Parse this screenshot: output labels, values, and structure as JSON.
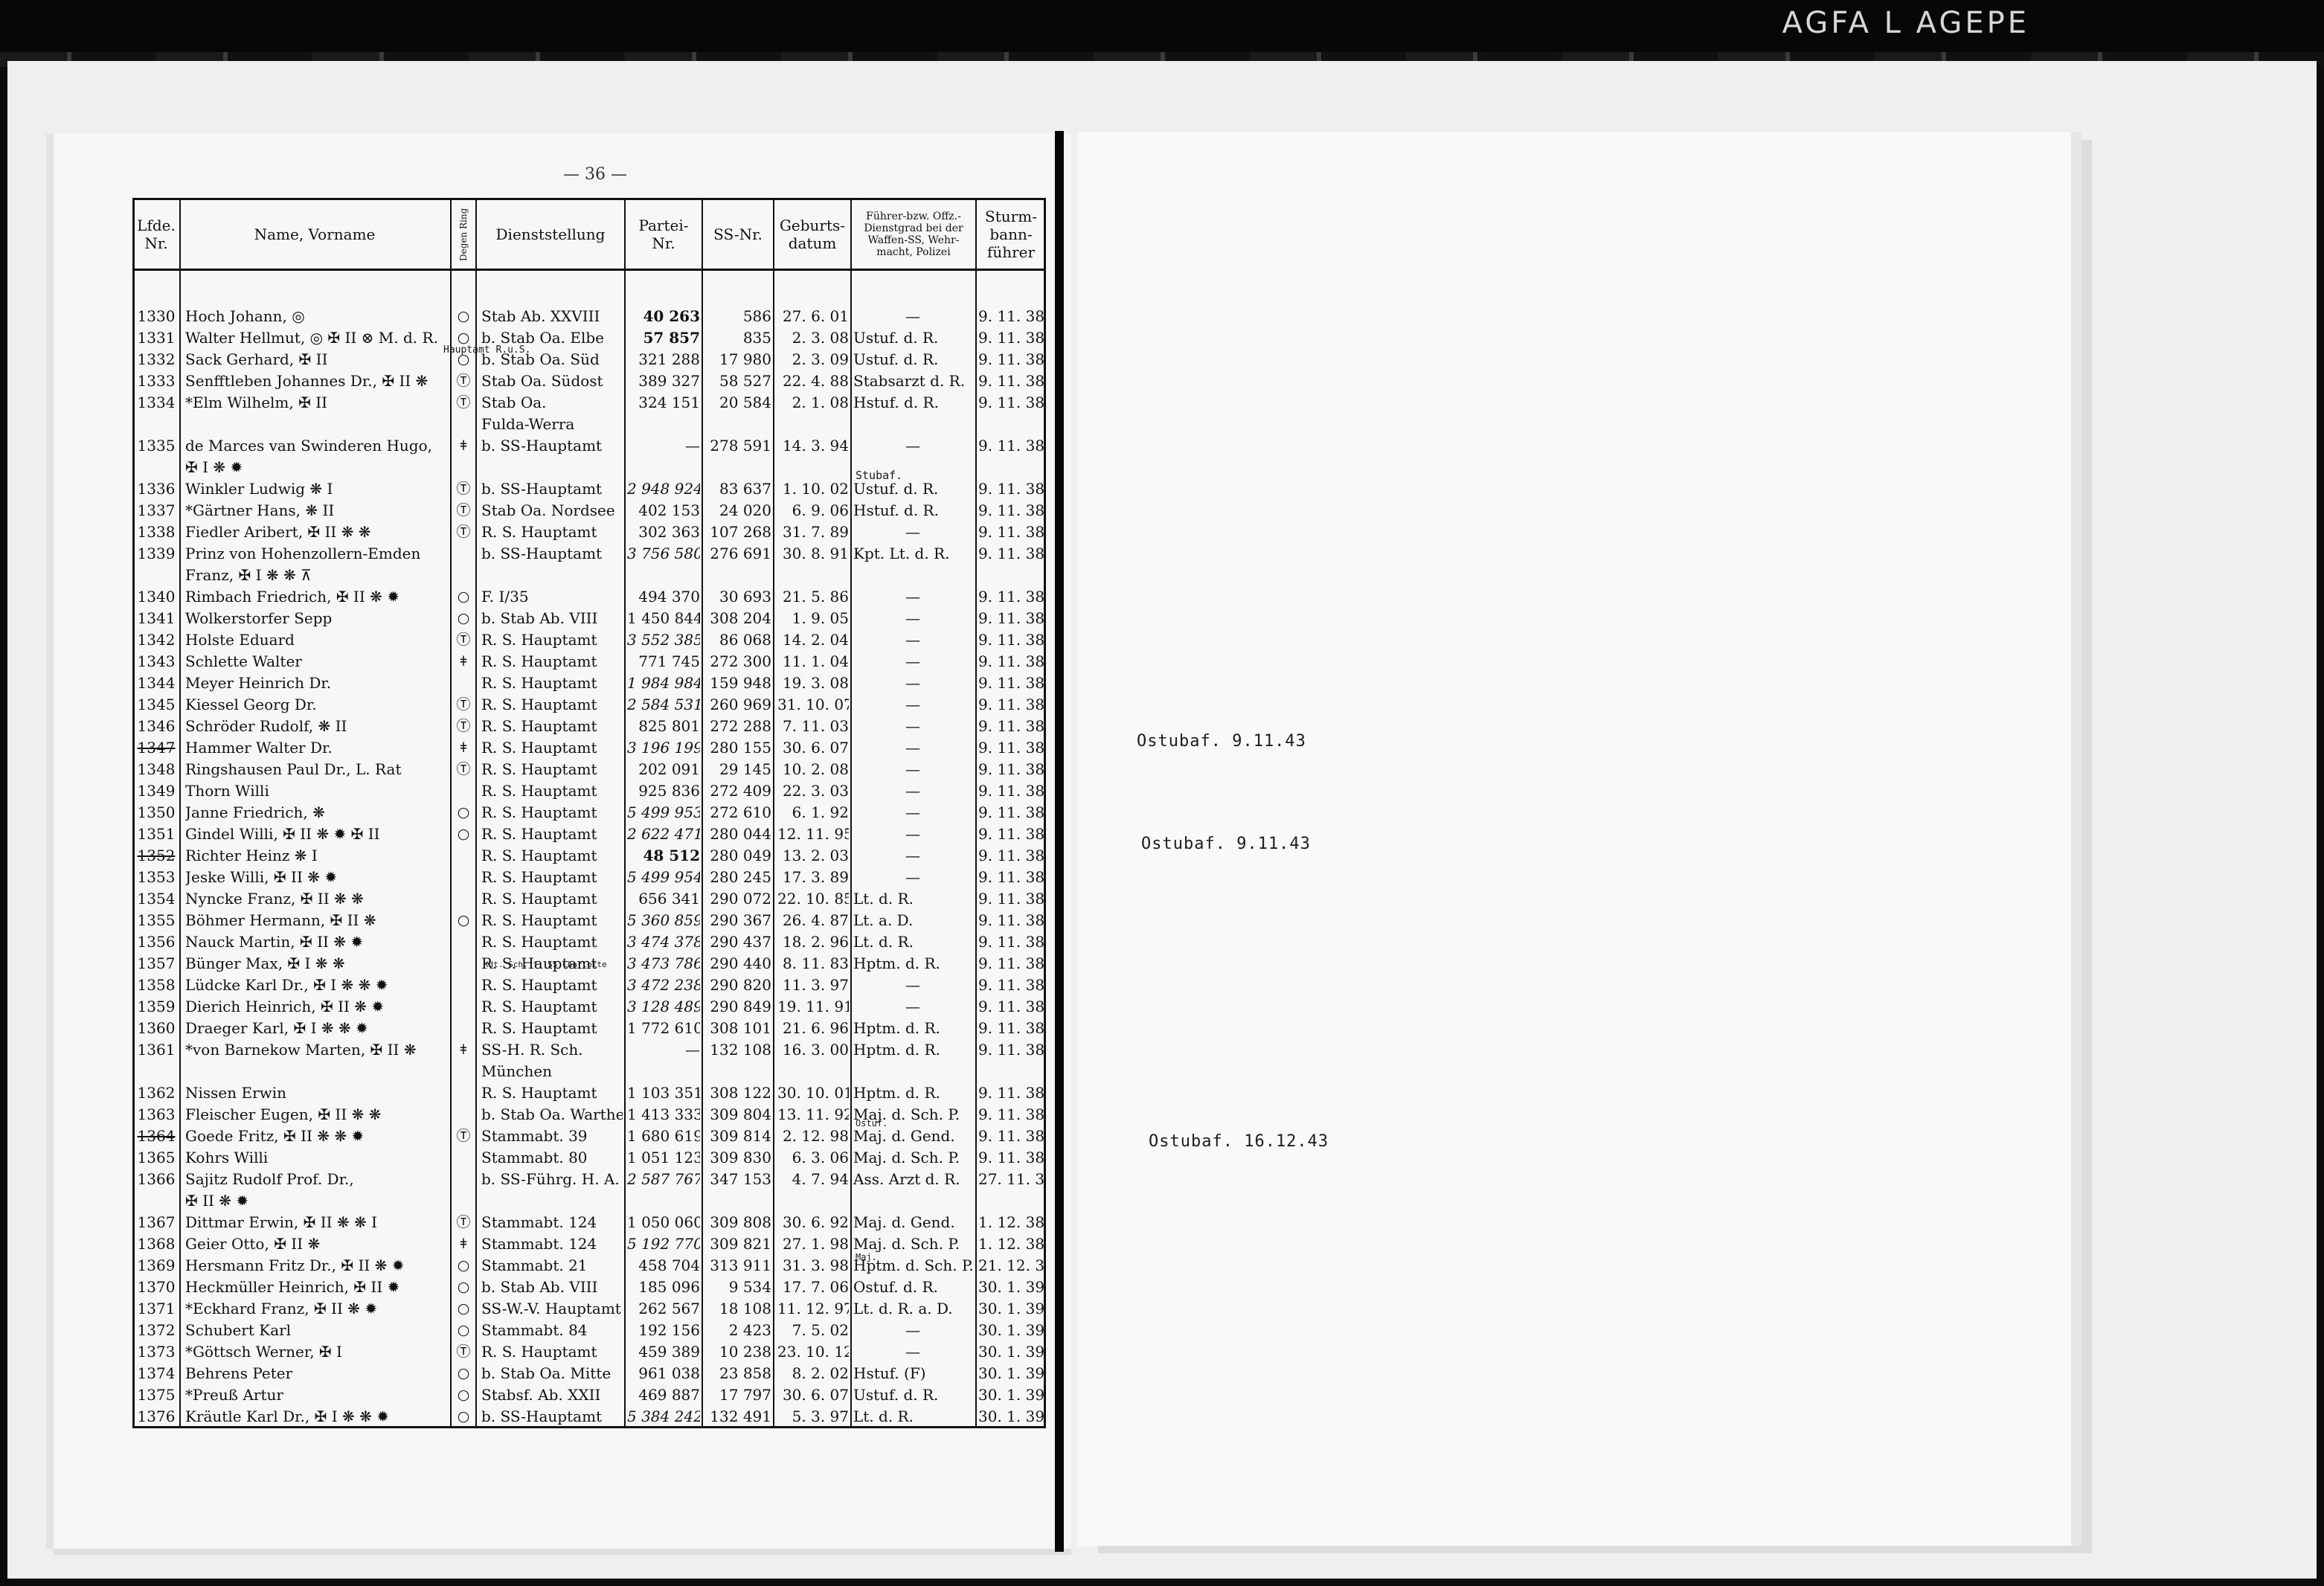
{
  "film": {
    "brand": "AGFA L AGEPE"
  },
  "page": {
    "number": "— 36 —"
  },
  "headers": {
    "nr": "Lfde.\nNr.",
    "name": "Name, Vorname",
    "ring": "Degen Ring",
    "dienst": "Dienststellung",
    "partei": "Partei-\nNr.",
    "ss": "SS-Nr.",
    "geb": "Geburts-\ndatum",
    "fuehrer": "Führer-bzw. Offz.-\nDienstgrad bei der\nWaffen-SS, Wehr-\nmacht, Polizei",
    "sturm": "Sturm-\nbann-\nführer"
  },
  "rows": [
    {
      "nr": "1330",
      "name": "Hoch Johann, ◎",
      "ring": "○",
      "dienst": "Stab Ab. XXVIII",
      "partei": "40 263",
      "ss": "586",
      "geb": "27.  6. 01",
      "fuehrer": "—",
      "sturm": "9. 11. 38"
    },
    {
      "nr": "1331",
      "name": "Walter Hellmut, ◎ ✠ II ⊗ M. d. R.",
      "ring": "○",
      "dienst": "b. Stab Oa. Elbe",
      "partei": "57 857",
      "ss": "835",
      "geb": "2.  3. 08",
      "fuehrer": "Ustuf. d. R.",
      "sturm": "9. 11. 38"
    },
    {
      "nr": "1332",
      "name": "Sack Gerhard, ✠ II",
      "ring": "○",
      "dienst": "b. Stab Oa. Süd",
      "partei": "321 288",
      "ss": "17 980",
      "geb": "2.  3. 09",
      "fuehrer": "Ustuf. d. R.",
      "sturm": "9. 11. 38"
    },
    {
      "nr": "1333",
      "name": "Senfftleben Johannes Dr., ✠ II ❋",
      "ring": "Ⓣ",
      "dienst": "Stab Oa. Südost",
      "partei": "389 327",
      "ss": "58 527",
      "geb": "22.  4. 88",
      "fuehrer": "Stabsarzt d. R.",
      "sturm": "9. 11. 38"
    },
    {
      "nr": "1334",
      "name": "*Elm Wilhelm, ✠ II",
      "ring": "Ⓣ",
      "dienst": "Stab Oa.",
      "partei": "324 151",
      "ss": "20 584",
      "geb": "2.  1. 08",
      "fuehrer": "Hstuf. d. R.",
      "sturm": "9. 11. 38"
    },
    {
      "nr": "",
      "name": "",
      "ring": "",
      "dienst": "Fulda-Werra",
      "partei": "",
      "ss": "",
      "geb": "",
      "fuehrer": "",
      "sturm": ""
    },
    {
      "nr": "1335",
      "name": "de Marces van Swinderen Hugo,",
      "ring": "ǂ",
      "dienst": "b. SS-Hauptamt",
      "partei": "—",
      "ss": "278 591",
      "geb": "14.  3. 94",
      "fuehrer": "—",
      "sturm": "9. 11. 38"
    },
    {
      "nr": "",
      "name": "✠ I ❋ ✹",
      "ring": "",
      "dienst": "",
      "partei": "",
      "ss": "",
      "geb": "",
      "fuehrer": "",
      "sturm": ""
    },
    {
      "nr": "1336",
      "name": "Winkler Ludwig ❋ I",
      "ring": "Ⓣ",
      "dienst": "b. SS-Hauptamt",
      "partei": "2 948 924",
      "ss": "83 637",
      "geb": "1. 10. 02",
      "fuehrer": "Ustuf. d. R.",
      "sturm": "9. 11. 38"
    },
    {
      "nr": "1337",
      "name": "*Gärtner Hans, ❋ II",
      "ring": "Ⓣ",
      "dienst": "Stab Oa. Nordsee",
      "partei": "402 153",
      "ss": "24 020",
      "geb": "6.  9. 06",
      "fuehrer": "Hstuf. d. R.",
      "sturm": "9. 11. 38"
    },
    {
      "nr": "1338",
      "name": "Fiedler Aribert, ✠ II ❋ ❋",
      "ring": "Ⓣ",
      "dienst": "R. S. Hauptamt",
      "partei": "302 363",
      "ss": "107 268",
      "geb": "31.  7. 89",
      "fuehrer": "—",
      "sturm": "9. 11. 38"
    },
    {
      "nr": "1339",
      "name": "Prinz von Hohenzollern-Emden",
      "ring": "",
      "dienst": "b. SS-Hauptamt",
      "partei": "3 756 580",
      "ss": "276 691",
      "geb": "30.  8. 91",
      "fuehrer": "Kpt. Lt. d. R.",
      "sturm": "9. 11. 38"
    },
    {
      "nr": "",
      "name": "Franz, ✠ I ❋ ❋ ⊼",
      "ring": "",
      "dienst": "",
      "partei": "",
      "ss": "",
      "geb": "",
      "fuehrer": "",
      "sturm": ""
    },
    {
      "nr": "1340",
      "name": "Rimbach Friedrich, ✠ II ❋ ✹",
      "ring": "○",
      "dienst": "F. I/35",
      "partei": "494 370",
      "ss": "30 693",
      "geb": "21.  5. 86",
      "fuehrer": "—",
      "sturm": "9. 11. 38"
    },
    {
      "nr": "1341",
      "name": "Wolkerstorfer Sepp",
      "ring": "○",
      "dienst": "b. Stab Ab. VIII",
      "partei": "1 450 844",
      "ss": "308 204",
      "geb": "1.  9. 05",
      "fuehrer": "—",
      "sturm": "9. 11. 38"
    },
    {
      "nr": "1342",
      "name": "Holste Eduard",
      "ring": "Ⓣ",
      "dienst": "R. S. Hauptamt",
      "partei": "3 552 385",
      "ss": "86 068",
      "geb": "14.  2. 04",
      "fuehrer": "—",
      "sturm": "9. 11. 38"
    },
    {
      "nr": "1343",
      "name": "Schlette Walter",
      "ring": "ǂ",
      "dienst": "R. S. Hauptamt",
      "partei": "771 745",
      "ss": "272 300",
      "geb": "11.  1. 04",
      "fuehrer": "—",
      "sturm": "9. 11. 38"
    },
    {
      "nr": "1344",
      "name": "Meyer Heinrich Dr.",
      "ring": "",
      "dienst": "R. S. Hauptamt",
      "partei": "1 984 984",
      "ss": "159 948",
      "geb": "19.  3. 08",
      "fuehrer": "—",
      "sturm": "9. 11. 38"
    },
    {
      "nr": "1345",
      "name": "Kiessel Georg Dr.",
      "ring": "Ⓣ",
      "dienst": "R. S. Hauptamt",
      "partei": "2 584 531",
      "ss": "260 969",
      "geb": "31. 10. 07",
      "fuehrer": "—",
      "sturm": "9. 11. 38"
    },
    {
      "nr": "1346",
      "name": "Schröder Rudolf, ❋ II",
      "ring": "Ⓣ",
      "dienst": "R. S. Hauptamt",
      "partei": "825 801",
      "ss": "272 288",
      "geb": "7. 11. 03",
      "fuehrer": "—",
      "sturm": "9. 11. 38"
    },
    {
      "nr": "1347",
      "name": "Hammer Walter Dr.",
      "ring": "ǂ",
      "dienst": "R. S. Hauptamt",
      "partei": "3 196 199",
      "ss": "280 155",
      "geb": "30.  6. 07",
      "fuehrer": "—",
      "sturm": "9. 11. 38"
    },
    {
      "nr": "1348",
      "name": "Ringshausen Paul Dr., L. Rat",
      "ring": "Ⓣ",
      "dienst": "R. S. Hauptamt",
      "partei": "202 091",
      "ss": "29 145",
      "geb": "10.  2. 08",
      "fuehrer": "—",
      "sturm": "9. 11. 38"
    },
    {
      "nr": "1349",
      "name": "Thorn Willi",
      "ring": "",
      "dienst": "R. S. Hauptamt",
      "partei": "925 836",
      "ss": "272 409",
      "geb": "22.  3. 03",
      "fuehrer": "—",
      "sturm": "9. 11. 38"
    },
    {
      "nr": "1350",
      "name": "Janne Friedrich, ❋",
      "ring": "○",
      "dienst": "R. S. Hauptamt",
      "partei": "5 499 953",
      "ss": "272 610",
      "geb": "6.  1. 92",
      "fuehrer": "—",
      "sturm": "9. 11. 38"
    },
    {
      "nr": "1351",
      "name": "Gindel Willi, ✠ II ❋ ✹ ✠ II",
      "ring": "○",
      "dienst": "R. S. Hauptamt",
      "partei": "2 622 471",
      "ss": "280 044",
      "geb": "12. 11. 95",
      "fuehrer": "—",
      "sturm": "9. 11. 38"
    },
    {
      "nr": "1352",
      "name": "Richter Heinz ❋ I",
      "ring": "",
      "dienst": "R. S. Hauptamt",
      "partei": "48 512",
      "ss": "280 049",
      "geb": "13.  2. 03",
      "fuehrer": "—",
      "sturm": "9. 11. 38"
    },
    {
      "nr": "1353",
      "name": "Jeske Willi, ✠ II ❋ ✹",
      "ring": "",
      "dienst": "R. S. Hauptamt",
      "partei": "5 499 954",
      "ss": "280 245",
      "geb": "17.  3. 89",
      "fuehrer": "—",
      "sturm": "9. 11. 38"
    },
    {
      "nr": "1354",
      "name": "Nyncke Franz, ✠ II ❋ ❋",
      "ring": "",
      "dienst": "R. S. Hauptamt",
      "partei": "656 341",
      "ss": "290 072",
      "geb": "22. 10. 85",
      "fuehrer": "Lt. d. R.",
      "sturm": "9. 11. 38"
    },
    {
      "nr": "1355",
      "name": "Böhmer Hermann, ✠ II ❋",
      "ring": "○",
      "dienst": "R. S. Hauptamt",
      "partei": "5 360 859",
      "ss": "290 367",
      "geb": "26.  4. 87",
      "fuehrer": "Lt. a. D.",
      "sturm": "9. 11. 38"
    },
    {
      "nr": "1356",
      "name": "Nauck Martin, ✠ II ❋ ✹",
      "ring": "",
      "dienst": "R. S. Hauptamt",
      "partei": "3 474 378",
      "ss": "290 437",
      "geb": "18.  2. 96",
      "fuehrer": "Lt. d. R.",
      "sturm": "9. 11. 38"
    },
    {
      "nr": "1357",
      "name": "Bünger Max, ✠ I ❋ ❋",
      "ring": "",
      "dienst": "R. S. Hauptamt",
      "partei": "3 473 786",
      "ss": "290 440",
      "geb": "8. 11. 83",
      "fuehrer": "Hptm. d. R.",
      "sturm": "9. 11. 38"
    },
    {
      "nr": "1358",
      "name": "Lüdcke Karl Dr., ✠ I ❋ ❋ ✹",
      "ring": "",
      "dienst": "R. S. Hauptamt",
      "partei": "3 472 238",
      "ss": "290 820",
      "geb": "11.  3. 97",
      "fuehrer": "—",
      "sturm": "9. 11. 38"
    },
    {
      "nr": "1359",
      "name": "Dierich Heinrich, ✠ II ❋ ✹",
      "ring": "",
      "dienst": "R. S. Hauptamt",
      "partei": "3 128 489",
      "ss": "290 849",
      "geb": "19. 11. 91",
      "fuehrer": "—",
      "sturm": "9. 11. 38"
    },
    {
      "nr": "1360",
      "name": "Draeger Karl, ✠ I ❋ ❋ ✹",
      "ring": "",
      "dienst": "R. S. Hauptamt",
      "partei": "1 772 610",
      "ss": "308 101",
      "geb": "21.  6. 96",
      "fuehrer": "Hptm. d. R.",
      "sturm": "9. 11. 38"
    },
    {
      "nr": "1361",
      "name": "*von Barnekow Marten, ✠ II ❋",
      "ring": "ǂ",
      "dienst": "SS-H. R. Sch.",
      "partei": "—",
      "ss": "132 108",
      "geb": "16.  3. 00",
      "fuehrer": "Hptm. d. R.",
      "sturm": "9. 11. 38"
    },
    {
      "nr": "",
      "name": "",
      "ring": "",
      "dienst": "München",
      "partei": "",
      "ss": "",
      "geb": "",
      "fuehrer": "",
      "sturm": ""
    },
    {
      "nr": "1362",
      "name": "Nissen Erwin",
      "ring": "",
      "dienst": "R. S. Hauptamt",
      "partei": "1 103 351",
      "ss": "308 122",
      "geb": "30. 10. 01",
      "fuehrer": "Hptm. d. R.",
      "sturm": "9. 11. 38"
    },
    {
      "nr": "1363",
      "name": "Fleischer Eugen, ✠ II ❋ ❋",
      "ring": "",
      "dienst": "b. Stab Oa. Warthe",
      "partei": "1 413 333",
      "ss": "309 804",
      "geb": "13. 11. 92",
      "fuehrer": "Maj. d. Sch. P.",
      "sturm": "9. 11. 38"
    },
    {
      "nr": "1364",
      "name": "Goede Fritz, ✠ II ❋ ❋ ✹",
      "ring": "Ⓣ",
      "dienst": "Stammabt. 39",
      "partei": "1 680 619",
      "ss": "309 814",
      "geb": "2. 12. 98",
      "fuehrer": "Maj. d. Gend.",
      "sturm": "9. 11. 38"
    },
    {
      "nr": "1365",
      "name": "Kohrs Willi",
      "ring": "",
      "dienst": "Stammabt. 80",
      "partei": "1 051 123",
      "ss": "309 830",
      "geb": "6.  3. 06",
      "fuehrer": "Maj. d. Sch. P.",
      "sturm": "9. 11. 38"
    },
    {
      "nr": "1366",
      "name": "Sajitz Rudolf Prof. Dr.,",
      "ring": "",
      "dienst": "b. SS-Führg. H. A.",
      "partei": "2 587 767",
      "ss": "347 153",
      "geb": "4.  7. 94",
      "fuehrer": "Ass. Arzt d. R.",
      "sturm": "27. 11. 38"
    },
    {
      "nr": "",
      "name": "✠ II ❋ ✹",
      "ring": "",
      "dienst": "",
      "partei": "",
      "ss": "",
      "geb": "",
      "fuehrer": "",
      "sturm": ""
    },
    {
      "nr": "1367",
      "name": "Dittmar Erwin, ✠ II ❋ ❋ I",
      "ring": "Ⓣ",
      "dienst": "Stammabt. 124",
      "partei": "1 050 060",
      "ss": "309 808",
      "geb": "30.  6. 92",
      "fuehrer": "Maj. d. Gend.",
      "sturm": "1. 12. 38"
    },
    {
      "nr": "1368",
      "name": "Geier Otto, ✠ II ❋",
      "ring": "ǂ",
      "dienst": "Stammabt. 124",
      "partei": "5 192 770",
      "ss": "309 821",
      "geb": "27.  1. 98",
      "fuehrer": "Maj. d. Sch. P.",
      "sturm": "1. 12. 38"
    },
    {
      "nr": "1369",
      "name": "Hersmann Fritz Dr., ✠ II ❋ ✹",
      "ring": "○",
      "dienst": "Stammabt. 21",
      "partei": "458 704",
      "ss": "313 911",
      "geb": "31.  3. 98",
      "fuehrer": "Hptm. d. Sch. P.",
      "sturm": "21. 12. 38"
    },
    {
      "nr": "1370",
      "name": "Heckmüller Heinrich, ✠ II ✹",
      "ring": "○",
      "dienst": "b. Stab Ab. VIII",
      "partei": "185 096",
      "ss": "9 534",
      "geb": "17.  7. 06",
      "fuehrer": "Ostuf. d. R.",
      "sturm": "30.  1. 39"
    },
    {
      "nr": "1371",
      "name": "*Eckhard Franz, ✠ II ❋ ✹",
      "ring": "○",
      "dienst": "SS-W.-V. Hauptamt",
      "partei": "262 567",
      "ss": "18 108",
      "geb": "11. 12. 97",
      "fuehrer": "Lt. d. R. a. D.",
      "sturm": "30.  1. 39"
    },
    {
      "nr": "1372",
      "name": "Schubert Karl",
      "ring": "○",
      "dienst": "Stammabt. 84",
      "partei": "192 156",
      "ss": "2 423",
      "geb": "7.  5. 02",
      "fuehrer": "—",
      "sturm": "30.  1. 39"
    },
    {
      "nr": "1373",
      "name": "*Göttsch Werner, ✠ I",
      "ring": "Ⓣ",
      "dienst": "R. S. Hauptamt",
      "partei": "459 389",
      "ss": "10 238",
      "geb": "23. 10. 12",
      "fuehrer": "—",
      "sturm": "30.  1. 39"
    },
    {
      "nr": "1374",
      "name": "Behrens Peter",
      "ring": "○",
      "dienst": "b. Stab Oa. Mitte",
      "partei": "961 038",
      "ss": "23 858",
      "geb": "8.  2. 02",
      "fuehrer": "Hstuf. (F)",
      "sturm": "30.  1. 39"
    },
    {
      "nr": "1375",
      "name": "*Preuß Artur",
      "ring": "○",
      "dienst": "Stabsf. Ab. XXII",
      "partei": "469 887",
      "ss": "17 797",
      "geb": "30.  6. 07",
      "fuehrer": "Ustuf. d. R.",
      "sturm": "30.  1. 39"
    },
    {
      "nr": "1376",
      "name": "Kräutle Karl Dr., ✠ I ❋ ❋ ✹",
      "ring": "○",
      "dienst": "b. SS-Hauptamt",
      "partei": "5 384 242",
      "ss": "132 491",
      "geb": "5.  3. 97",
      "fuehrer": "Lt. d. R.",
      "sturm": "30.  1. 39"
    }
  ],
  "annotations": {
    "ostubaf_1": "Ostubaf. 9.11.43",
    "ostubaf_2": "Ostubaf. 9.11.43",
    "ostubaf_3": "Ostubaf. 16.12.43",
    "hauptamt_correction": "Hauptamt R.u.S.",
    "stubaf": "Stubaf.",
    "ostuf": "Ostuf.",
    "maj": "Maj.",
    "kdt_note": "Kdt. Sch. f. SS Charlotte"
  }
}
